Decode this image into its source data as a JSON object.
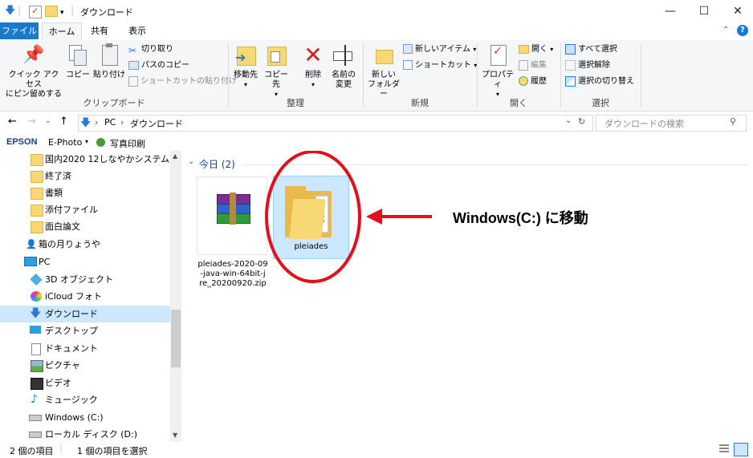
{
  "window": {
    "title": "ダウンロード",
    "minimize_label": "—",
    "maximize_label": "☐",
    "close_label": "✕"
  },
  "tabs": [
    {
      "label": "ファイル"
    },
    {
      "label": "ホーム"
    },
    {
      "label": "共有"
    },
    {
      "label": "表示"
    }
  ],
  "ribbon": {
    "clipboard": {
      "pin_label_1": "クイック アクセス",
      "pin_label_2": "にピン留めする",
      "copy_label": "コピー",
      "paste_label": "貼り付け",
      "cut_label": "切り取り",
      "copy_path_label": "パスのコピー",
      "paste_shortcut_label": "ショートカットの貼り付け",
      "group_label": "クリップボード"
    },
    "organize": {
      "move_label": "移動先",
      "copyto_label": "コピー先",
      "delete_label": "削除",
      "rename_label_1": "名前の",
      "rename_label_2": "変更",
      "group_label": "整理"
    },
    "new": {
      "new_folder_label_1": "新しい",
      "new_folder_label_2": "フォルダー",
      "new_item_label": "新しいアイテム",
      "shortcut_label": "ショートカット",
      "group_label": "新規"
    },
    "open": {
      "properties_label": "プロパティ",
      "open_label": "開く",
      "edit_label": "編集",
      "history_label": "履歴",
      "group_label": "開く"
    },
    "select": {
      "select_all_label": "すべて選択",
      "select_none_label": "選択解除",
      "invert_label": "選択の切り替え",
      "group_label": "選択"
    }
  },
  "address": {
    "crumb_pc": "PC",
    "crumb_downloads": "ダウンロード",
    "search_placeholder": "ダウンロードの検索"
  },
  "epson_bar": {
    "brand": "EPSON",
    "app": "E-Photo",
    "print_label": "写真印刷"
  },
  "nav": {
    "items": [
      {
        "label": "国内2020 12しなやかシステム"
      },
      {
        "label": "終了済"
      },
      {
        "label": "書類"
      },
      {
        "label": "添付ファイル"
      },
      {
        "label": "面白論文"
      },
      {
        "label": "箱の月りょうや"
      },
      {
        "label": "PC"
      },
      {
        "label": "3D オブジェクト"
      },
      {
        "label": "iCloud フォト"
      },
      {
        "label": "ダウンロード"
      },
      {
        "label": "デスクトップ"
      },
      {
        "label": "ドキュメント"
      },
      {
        "label": "ピクチャ"
      },
      {
        "label": "ビデオ"
      },
      {
        "label": "ミュージック"
      },
      {
        "label": "Windows (C:)"
      },
      {
        "label": "ローカル ディスク (D:)"
      }
    ]
  },
  "content": {
    "group_header": "今日 (2)",
    "files": [
      {
        "name_1": "pleiades-2020-09",
        "name_2": "-java-win-64bit-j",
        "name_3": "re_20200920.zip",
        "icon": "winrar-archive-icon"
      },
      {
        "name_1": "pleiades",
        "icon": "folder-icon"
      }
    ],
    "annotation": "Windows(C:) に移動",
    "annotation_color": "#e3101c"
  },
  "status": {
    "count": "2 個の項目",
    "selected": "1 個の項目を選択"
  },
  "colors": {
    "accent": "#1979ca",
    "selection": "#cce8ff",
    "folder": "#f8d775"
  }
}
